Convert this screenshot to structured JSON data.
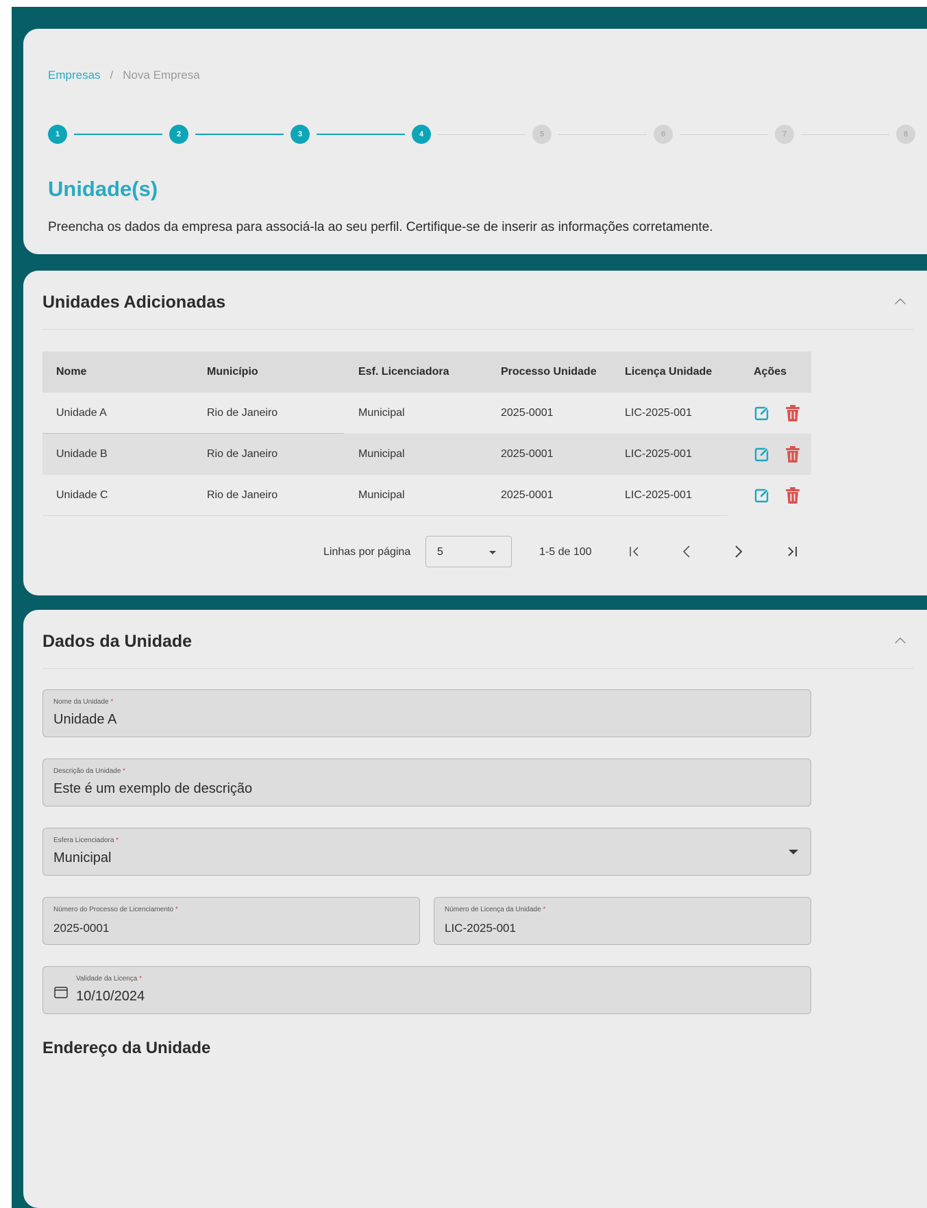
{
  "breadcrumb": {
    "root": "Empresas",
    "separator": "/",
    "current": "Nova Empresa"
  },
  "stepper": {
    "steps": [
      "1",
      "2",
      "3",
      "4",
      "5",
      "6",
      "7",
      "8"
    ],
    "active_count": 4
  },
  "intro": {
    "title": "Unidade(s)",
    "description": "Preencha os dados da empresa para associá-la ao seu perfil. Certifique-se de inserir as informações corretamente."
  },
  "units_table": {
    "title": "Unidades Adicionadas",
    "columns": [
      "Nome",
      "Município",
      "Esf. Licenciadora",
      "Processo Unidade",
      "Licença Unidade",
      "Ações"
    ],
    "rows": [
      [
        "Unidade A",
        "Rio de Janeiro",
        "Municipal",
        "2025-0001",
        "LIC-2025-001"
      ],
      [
        "Unidade B",
        "Rio de Janeiro",
        "Municipal",
        "2025-0001",
        "LIC-2025-001"
      ],
      [
        "Unidade C",
        "Rio de Janeiro",
        "Municipal",
        "2025-0001",
        "LIC-2025-001"
      ]
    ],
    "icons": {
      "edit": "edit-icon",
      "delete": "trash-icon"
    },
    "colors": {
      "edit": "#1aa7c4",
      "delete": "#d9534f"
    },
    "pagination": {
      "rows_per_page_label": "Linhas por página",
      "rows_per_page_value": "5",
      "range": "1-5 de 100"
    }
  },
  "unit_form": {
    "title": "Dados da Unidade",
    "nome": {
      "label": "Nome da Unidade",
      "value": "Unidade A"
    },
    "descricao": {
      "label": "Descrição da Unidade",
      "value": "Este é um exemplo de descrição"
    },
    "esfera": {
      "label": "Esfera Licenciadora",
      "value": "Municipal"
    },
    "processo": {
      "label": "Número do Processo de Licenciamento",
      "value": "2025-0001"
    },
    "licenca": {
      "label": "Número de Licença da Unidade",
      "value": "LIC-2025-001"
    },
    "validade": {
      "label": "Validade da Licença",
      "value": "10/10/2024"
    },
    "required_mark": "*",
    "address_title": "Endereço da Unidade"
  },
  "colors": {
    "background": "#075e66",
    "accent": "#0ea5b8",
    "card": "#ececec",
    "required": "#e04545"
  }
}
